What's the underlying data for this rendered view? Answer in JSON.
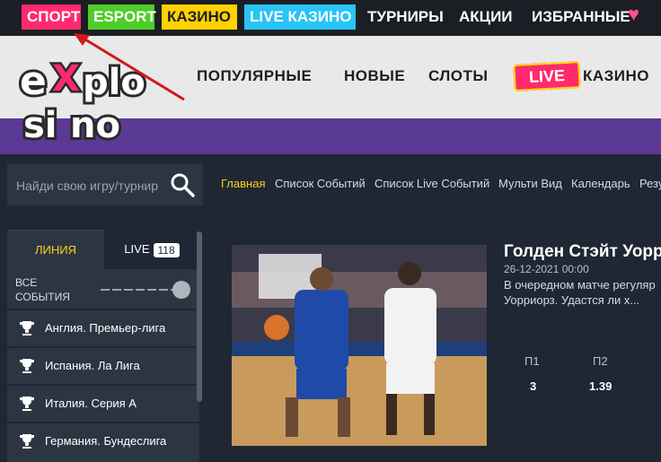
{
  "topnav": {
    "items": [
      {
        "label": "СПОРТ",
        "bg": "#ff2a6d",
        "color": "#ffffff"
      },
      {
        "label": "ESPORT",
        "bg": "#4fcd2a",
        "color": "#ffffff"
      },
      {
        "label": "КАЗИНО",
        "bg": "#ffd200",
        "color": "#1b1e24"
      },
      {
        "label": "LIVE КАЗИНО",
        "bg": "#28c4f5",
        "color": "#ffffff"
      },
      {
        "label": "ТУРНИРЫ",
        "bg": "transparent",
        "color": "#ffffff"
      },
      {
        "label": "АКЦИИ",
        "bg": "transparent",
        "color": "#ffffff"
      },
      {
        "label": "ИЗБРАННЫЕ",
        "bg": "transparent",
        "color": "#ffffff"
      }
    ],
    "heart_icon": "heart-icon"
  },
  "header": {
    "logo_text": "explosino",
    "nav": [
      "ПОПУЛЯРНЫЕ",
      "НОВЫЕ",
      "СЛОТЫ"
    ],
    "live_badge": "LIVE",
    "casino_label": "КАЗИНО"
  },
  "search": {
    "placeholder": "Найди свою игру/турнир"
  },
  "subnav": {
    "items": [
      "Главная",
      "Список Событий",
      "Список Live Событий",
      "Мульти Вид",
      "Календарь",
      "Резу"
    ]
  },
  "sidebar": {
    "tab_line": "ЛИНИЯ",
    "tab_live": "LIVE",
    "live_count": "118",
    "all_events_line1": "ВСЕ",
    "all_events_line2": "СОБЫТИЯ",
    "leagues": [
      {
        "label": "Англия. Премьер-лига"
      },
      {
        "label": "Испания. Ла Лига"
      },
      {
        "label": "Италия. Серия А"
      },
      {
        "label": "Германия. Бундеслига"
      }
    ]
  },
  "event": {
    "title": "Голден Стэйт Уорр",
    "date": "26-12-2021 00:00",
    "description": "В очередном матче регуляр Уорриорз. Удастся ли х...",
    "odds_head": [
      "П1",
      "П2"
    ],
    "odds_val": [
      "3",
      "1.39"
    ]
  },
  "colors": {
    "accent": "#ffcd1c",
    "brand_pink": "#ff2a6d",
    "purple": "#5a3a94"
  }
}
